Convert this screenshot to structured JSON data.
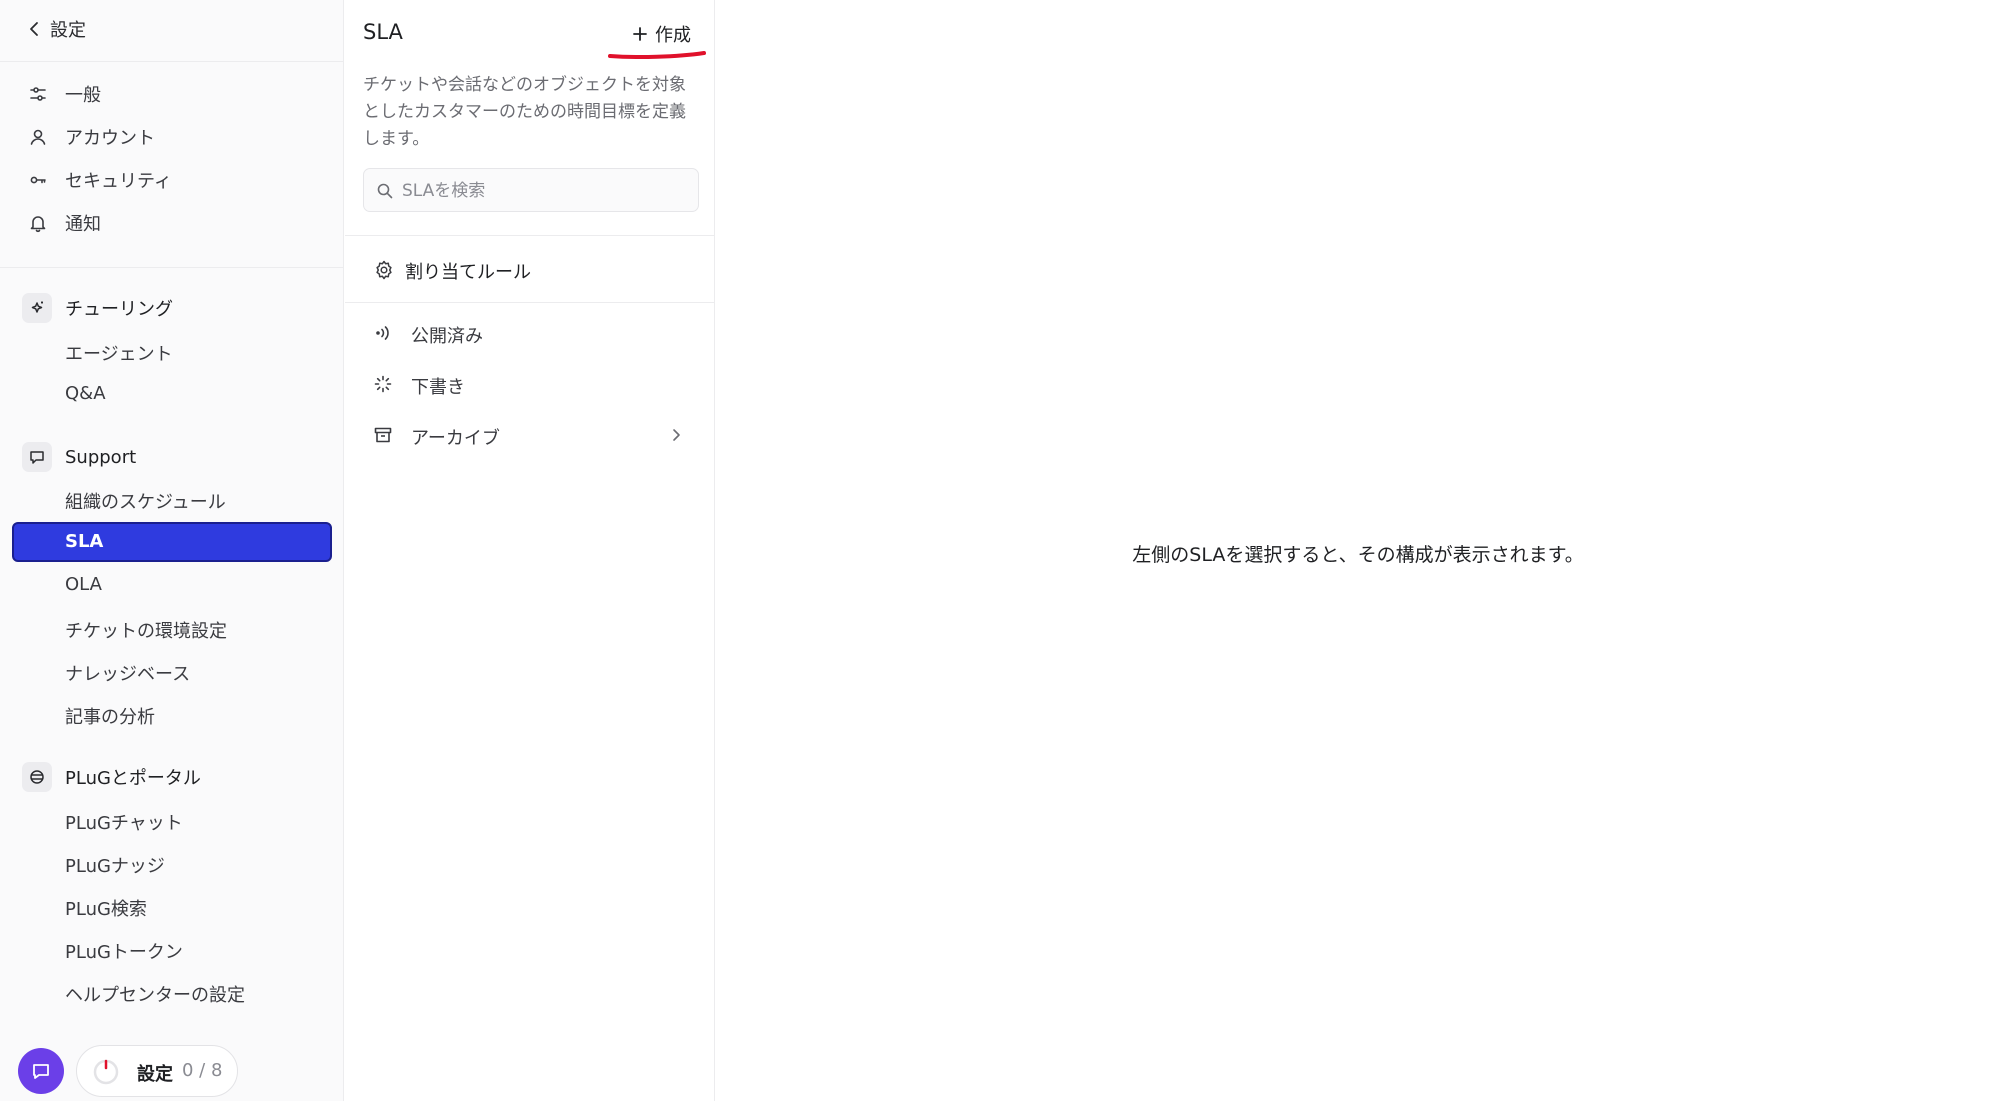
{
  "sidebar": {
    "back_label": "設定",
    "general_items": [
      {
        "label": "一般",
        "icon": "sliders-icon"
      },
      {
        "label": "アカウント",
        "icon": "user-icon"
      },
      {
        "label": "セキュリティ",
        "icon": "key-icon"
      },
      {
        "label": "通知",
        "icon": "bell-icon"
      }
    ],
    "groups": [
      {
        "title": "チューリング",
        "icon": "sparkle-icon",
        "items": [
          "エージェント",
          "Q&A"
        ]
      },
      {
        "title": "Support",
        "icon": "chat-bubble-icon",
        "items": [
          "組織のスケジュール",
          "SLA",
          "OLA",
          "チケットの環境設定",
          "ナレッジベース",
          "記事の分析"
        ]
      },
      {
        "title": "PLuGとポータル",
        "icon": "globe-icon",
        "items": [
          "PLuGチャット",
          "PLuGナッジ",
          "PLuG検索",
          "PLuGトークン",
          "ヘルプセンターの設定"
        ]
      }
    ],
    "active_item": "SLA",
    "setup_progress": {
      "label": "設定",
      "count": "0 / 8",
      "completed": 0,
      "total": 8
    }
  },
  "panel": {
    "title": "SLA",
    "create_label": "作成",
    "description": "チケットや会話などのオブジェクトを対象としたカスタマーのための時間目標を定義します。",
    "search_placeholder": "SLAを検索",
    "rules_label": "割り当てルール",
    "statuses": [
      {
        "label": "公開済み",
        "icon": "broadcast-icon"
      },
      {
        "label": "下書き",
        "icon": "draft-spinner-icon"
      },
      {
        "label": "アーカイブ",
        "icon": "archive-icon"
      }
    ]
  },
  "main": {
    "empty_message": "左側のSLAを選択すると、その構成が表示されます。"
  },
  "colors": {
    "active_bg": "#2f3bdf",
    "fab_bg": "#6b3fe8",
    "annotation_red": "#e0112b"
  }
}
